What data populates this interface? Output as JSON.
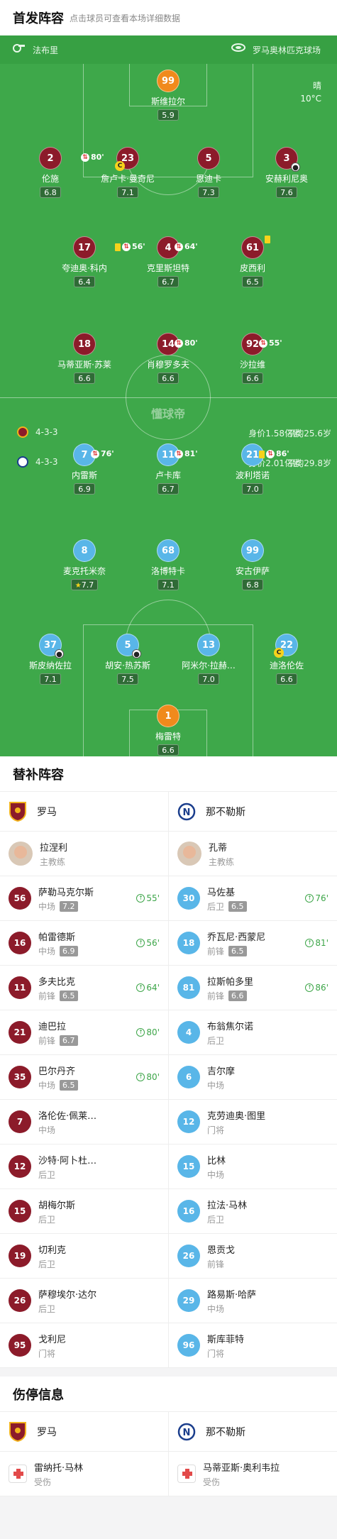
{
  "header": {
    "title": "首发阵容",
    "hint": "点击球员可查看本场详细数据"
  },
  "pitch": {
    "referee": "法布里",
    "stadium": "罗马奥林匹克球场",
    "weather": "晴",
    "temperature": "10°C",
    "watermark": "懂球帝",
    "home": {
      "formation": "4-3-3",
      "value": "身价1.58亿欧",
      "age": "平均25.6岁"
    },
    "away": {
      "formation": "4-3-3",
      "value": "身价2.01亿欧",
      "age": "平均29.8岁"
    }
  },
  "home_players": [
    {
      "num": "99",
      "name": "斯维拉尔",
      "rating": "5.9"
    },
    {
      "num": "2",
      "name": "伦施",
      "rating": "6.8",
      "sub": "80'"
    },
    {
      "num": "23",
      "name": "詹卢卡·曼奇尼",
      "rating": "7.1",
      "captain": "C"
    },
    {
      "num": "5",
      "name": "恩迪卡",
      "rating": "7.3"
    },
    {
      "num": "3",
      "name": "安赫利尼奥",
      "rating": "7.6"
    },
    {
      "num": "17",
      "name": "夸迪奥·科内",
      "rating": "6.4",
      "sub": "56'"
    },
    {
      "num": "4",
      "name": "克里斯坦特",
      "rating": "6.7",
      "sub": "64'"
    },
    {
      "num": "61",
      "name": "皮西利",
      "rating": "6.5"
    },
    {
      "num": "18",
      "name": "马蒂亚斯·苏莱",
      "rating": "6.6"
    },
    {
      "num": "14",
      "name": "肖穆罗多夫",
      "rating": "6.6",
      "sub": "80'"
    },
    {
      "num": "92",
      "name": "沙拉维",
      "rating": "6.6",
      "sub": "55'"
    }
  ],
  "away_players": [
    {
      "num": "7",
      "name": "内雷斯",
      "rating": "6.9",
      "sub": "76'"
    },
    {
      "num": "11",
      "name": "卢卡库",
      "rating": "6.7",
      "sub": "81'"
    },
    {
      "num": "21",
      "name": "波利塔诺",
      "rating": "7.0",
      "sub": "86'"
    },
    {
      "num": "8",
      "name": "麦克托米奈",
      "rating": "7.7"
    },
    {
      "num": "68",
      "name": "洛博特卡",
      "rating": "7.1"
    },
    {
      "num": "99",
      "name": "安古伊萨",
      "rating": "6.8"
    },
    {
      "num": "37",
      "name": "斯皮纳佐拉",
      "rating": "7.1"
    },
    {
      "num": "5",
      "name": "胡安·热苏斯",
      "rating": "7.5"
    },
    {
      "num": "13",
      "name": "阿米尔·拉赫…",
      "rating": "7.0"
    },
    {
      "num": "22",
      "name": "迪洛伦佐",
      "rating": "6.6",
      "captain": "C"
    },
    {
      "num": "1",
      "name": "梅雷特",
      "rating": "6.6"
    }
  ],
  "subs": {
    "title": "替补阵容",
    "home_team": "罗马",
    "away_team": "那不勒斯",
    "home_coach": {
      "name": "拉涅利",
      "role": "主教练"
    },
    "away_coach": {
      "name": "孔蒂",
      "role": "主教练"
    },
    "home": [
      {
        "num": "56",
        "name": "萨勒马克尔斯",
        "pos": "中场",
        "rating": "7.2",
        "time": "55'"
      },
      {
        "num": "16",
        "name": "帕雷德斯",
        "pos": "中场",
        "rating": "6.9",
        "time": "56'"
      },
      {
        "num": "11",
        "name": "多夫比克",
        "pos": "前锋",
        "rating": "6.5",
        "time": "64'"
      },
      {
        "num": "21",
        "name": "迪巴拉",
        "pos": "前锋",
        "rating": "6.7",
        "time": "80'"
      },
      {
        "num": "35",
        "name": "巴尔丹齐",
        "pos": "中场",
        "rating": "6.5",
        "time": "80'"
      },
      {
        "num": "7",
        "name": "洛伦佐·佩莱…",
        "pos": "中场"
      },
      {
        "num": "12",
        "name": "沙特·阿卜杜…",
        "pos": "后卫"
      },
      {
        "num": "15",
        "name": "胡梅尔斯",
        "pos": "后卫"
      },
      {
        "num": "19",
        "name": "切利克",
        "pos": "后卫"
      },
      {
        "num": "26",
        "name": "萨穆埃尔·达尔",
        "pos": "后卫"
      },
      {
        "num": "95",
        "name": "戈利尼",
        "pos": "门将"
      }
    ],
    "away": [
      {
        "num": "30",
        "name": "马佐基",
        "pos": "后卫",
        "rating": "6.5",
        "time": "76'"
      },
      {
        "num": "18",
        "name": "乔瓦尼·西蒙尼",
        "pos": "前锋",
        "rating": "6.5",
        "time": "81'"
      },
      {
        "num": "81",
        "name": "拉斯帕多里",
        "pos": "前锋",
        "rating": "6.6",
        "time": "86'"
      },
      {
        "num": "4",
        "name": "布翁焦尔诺",
        "pos": "后卫"
      },
      {
        "num": "6",
        "name": "吉尔摩",
        "pos": "中场"
      },
      {
        "num": "12",
        "name": "克劳迪奥·图里",
        "pos": "门将"
      },
      {
        "num": "15",
        "name": "比林",
        "pos": "中场"
      },
      {
        "num": "16",
        "name": "拉法·马林",
        "pos": "后卫"
      },
      {
        "num": "26",
        "name": "恩贡戈",
        "pos": "前锋"
      },
      {
        "num": "29",
        "name": "路易斯·哈萨",
        "pos": "中场"
      },
      {
        "num": "96",
        "name": "斯库菲特",
        "pos": "门将"
      }
    ]
  },
  "injuries": {
    "title": "伤停信息",
    "home_team": "罗马",
    "away_team": "那不勒斯",
    "home": [
      {
        "name": "雷纳托·马林",
        "status": "受伤"
      }
    ],
    "away": [
      {
        "name": "马蒂亚斯·奥利韦拉",
        "status": "受伤"
      }
    ]
  },
  "colors": {
    "pitch": "#3ea84a",
    "home": "#8c1b2a",
    "away": "#59b6e8",
    "gk": "#f08a1c",
    "sub_in": "#3ca548"
  }
}
